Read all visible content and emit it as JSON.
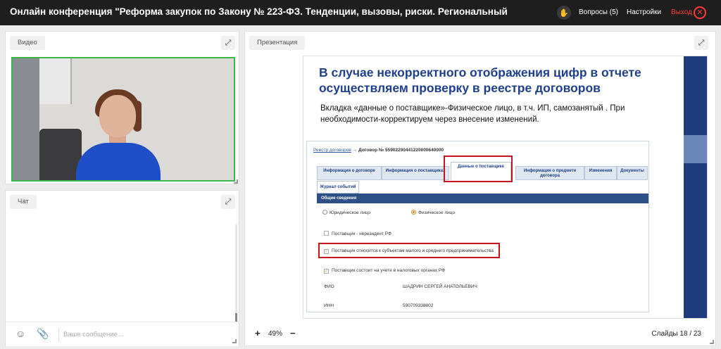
{
  "header": {
    "title": "Онлайн конференция \"Реформа закупок по Закону № 223-ФЗ. Тенденции, вызовы, риски. Региональный",
    "questions_label": "Вопросы (5)",
    "settings_label": "Настройки",
    "exit_label": "Выход",
    "exit_color": "#ff3b3b"
  },
  "video_panel": {
    "label": "Видео",
    "active_border_color": "#3ab54a"
  },
  "chat_panel": {
    "label": "Чат",
    "input_placeholder": "Ваше сообщение..."
  },
  "presentation_panel": {
    "label": "Презентация",
    "zoom": "49%",
    "slides_label": "Слайды",
    "current_slide": "18",
    "separator": "/",
    "total_slides": "23"
  },
  "slide": {
    "title_line1": "В случае некорректного отображения цифр в отчете",
    "title_line2": "осуществляем проверку в реестре договоров",
    "body": "Вкладка «данные о поставщике»-Физическое лицо, в т.ч. ИП, самозанятый . При необходимости-корректируем через внесение изменений.",
    "title_color": "#1f3e8c",
    "screenshot": {
      "breadcrumb_link": "Реестр договоров",
      "breadcrumb_arrow": "→",
      "breadcrumb_current": "Договор № 55902290441220000640000",
      "tabs": [
        "Информация о договоре",
        "Информация о поставщиках",
        "Данные о поставщике",
        "Информация о предмете договора",
        "Изменения",
        "Документы"
      ],
      "tab_journal": "Журнал событий",
      "section_title": "Общие сведения",
      "radio_legal": "Юридическое лицо",
      "radio_individual": "Физическое лицо",
      "cb_nonresident": "Поставщик - нерезидент РФ",
      "cb_sme": "Поставщик относится к субъектам малого и среднего предпринимательства",
      "cb_tax": "Поставщик состоит на учете в налоговых органах РФ",
      "fio_label": "ФИО",
      "fio_value": "ШАДРИН СЕРГЕЙ АНАТОЛЬЕВИЧ",
      "inn_label": "ИНН",
      "inn_value": "590709338802",
      "highlight_color": "#c8141e"
    }
  }
}
